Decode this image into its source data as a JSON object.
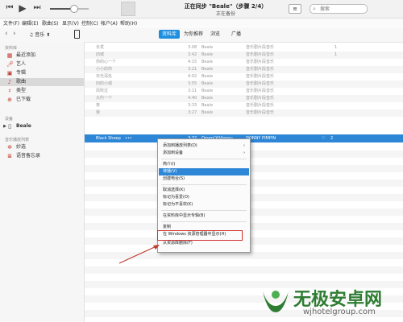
{
  "titlebar": {
    "now_playing_title": "正在同步 \"Beale\"（步骤 2/4）",
    "now_playing_subtitle": "正在备份",
    "search_placeholder": "搜索",
    "volume_level": 0.6
  },
  "menubar": {
    "items": [
      "文件(F)",
      "编辑(E)",
      "歌曲(S)",
      "显示(V)",
      "控制(C)",
      "帐户(A)",
      "帮助(H)"
    ]
  },
  "navbar": {
    "media_type": "音乐",
    "tabs": [
      "资料库",
      "为你推荐",
      "浏览",
      "广播"
    ],
    "active_tab": "资料库"
  },
  "sidebar": {
    "library_header": "资料库",
    "library_items": [
      {
        "label": "最近添加",
        "icon": "recent-icon"
      },
      {
        "label": "艺人",
        "icon": "microphone-icon"
      },
      {
        "label": "专辑",
        "icon": "album-icon"
      },
      {
        "label": "歌曲",
        "icon": "note-icon"
      },
      {
        "label": "类型",
        "icon": "genre-icon"
      },
      {
        "label": "已下载",
        "icon": "download-icon"
      }
    ],
    "devices_header": "设备",
    "device_name": "Beale",
    "playlists_header": "音乐播放列表",
    "playlist_items": [
      {
        "label": "妙选",
        "icon": "genius-icon"
      },
      {
        "label": "语音备忘录",
        "icon": "voice-memo-icon"
      }
    ]
  },
  "songs": {
    "rows": [
      {
        "name": "长发",
        "time": "3:08",
        "artist": "Beale",
        "album": "音乐剧片段音乐",
        "plays": "1"
      },
      {
        "name": "旧城",
        "time": "3:42",
        "artist": "Beale",
        "album": "音乐剧片段音乐",
        "plays": "1"
      },
      {
        "name": "你的心一个",
        "time": "4:15",
        "artist": "Beale",
        "album": "音乐剧片段音乐",
        "plays": ""
      },
      {
        "name": "小小的你",
        "time": "3:21",
        "artist": "Beale",
        "album": "音乐剧片段音乐",
        "plays": ""
      },
      {
        "name": "日光深处",
        "time": "4:02",
        "artist": "Beale",
        "album": "音乐剧片段音乐",
        "plays": ""
      },
      {
        "name": "旧的小城",
        "time": "3:55",
        "artist": "Beale",
        "album": "音乐剧片段音乐",
        "plays": ""
      },
      {
        "name": "风吹过",
        "time": "3:11",
        "artist": "Beale",
        "album": "音乐剧片段音乐",
        "plays": ""
      },
      {
        "name": "大约一个",
        "time": "4:40",
        "artist": "Beale",
        "album": "音乐剧片段音乐",
        "plays": ""
      },
      {
        "name": "夜",
        "time": "3:33",
        "artist": "Beale",
        "album": "音乐剧片段音乐",
        "plays": ""
      },
      {
        "name": "我",
        "time": "3:27",
        "artist": "Beale",
        "album": "音乐剧片段音乐",
        "plays": ""
      }
    ],
    "selected_row": {
      "name": "Black Sheep",
      "more": "•••",
      "time": "3:32",
      "artist": "Omen(XiVignsu...",
      "album": "SKINNY PIMPIN",
      "heart": "♡",
      "plays": "2"
    }
  },
  "context_menu": {
    "items": [
      {
        "label": "添加到播放列表(D)",
        "submenu": true
      },
      {
        "label": "添加到设备",
        "submenu": true
      },
      {
        "separator": true
      },
      {
        "label": "简介(I)"
      },
      {
        "label": "待播(V)",
        "highlighted": true
      },
      {
        "label": "创建电台(S)"
      },
      {
        "separator": true
      },
      {
        "label": "取消选择(K)"
      },
      {
        "label": "标记为喜爱(O)"
      },
      {
        "label": "标记为不喜欢(K)"
      },
      {
        "separator": true
      },
      {
        "label": "在资料库中显示专辑(B)"
      },
      {
        "separator": true
      },
      {
        "label": "复制"
      },
      {
        "label": "在 Windows 资源管理器中显示(H)",
        "boxed": true
      },
      {
        "label": "从资源库删除(F)"
      }
    ]
  },
  "watermark": {
    "brand": "无极安卓网",
    "url": "wjhotelgroup.com"
  },
  "colors": {
    "accent": "#2d86d6",
    "highlight_box": "#d32f2f",
    "watermark_green": "#2e7d32"
  }
}
